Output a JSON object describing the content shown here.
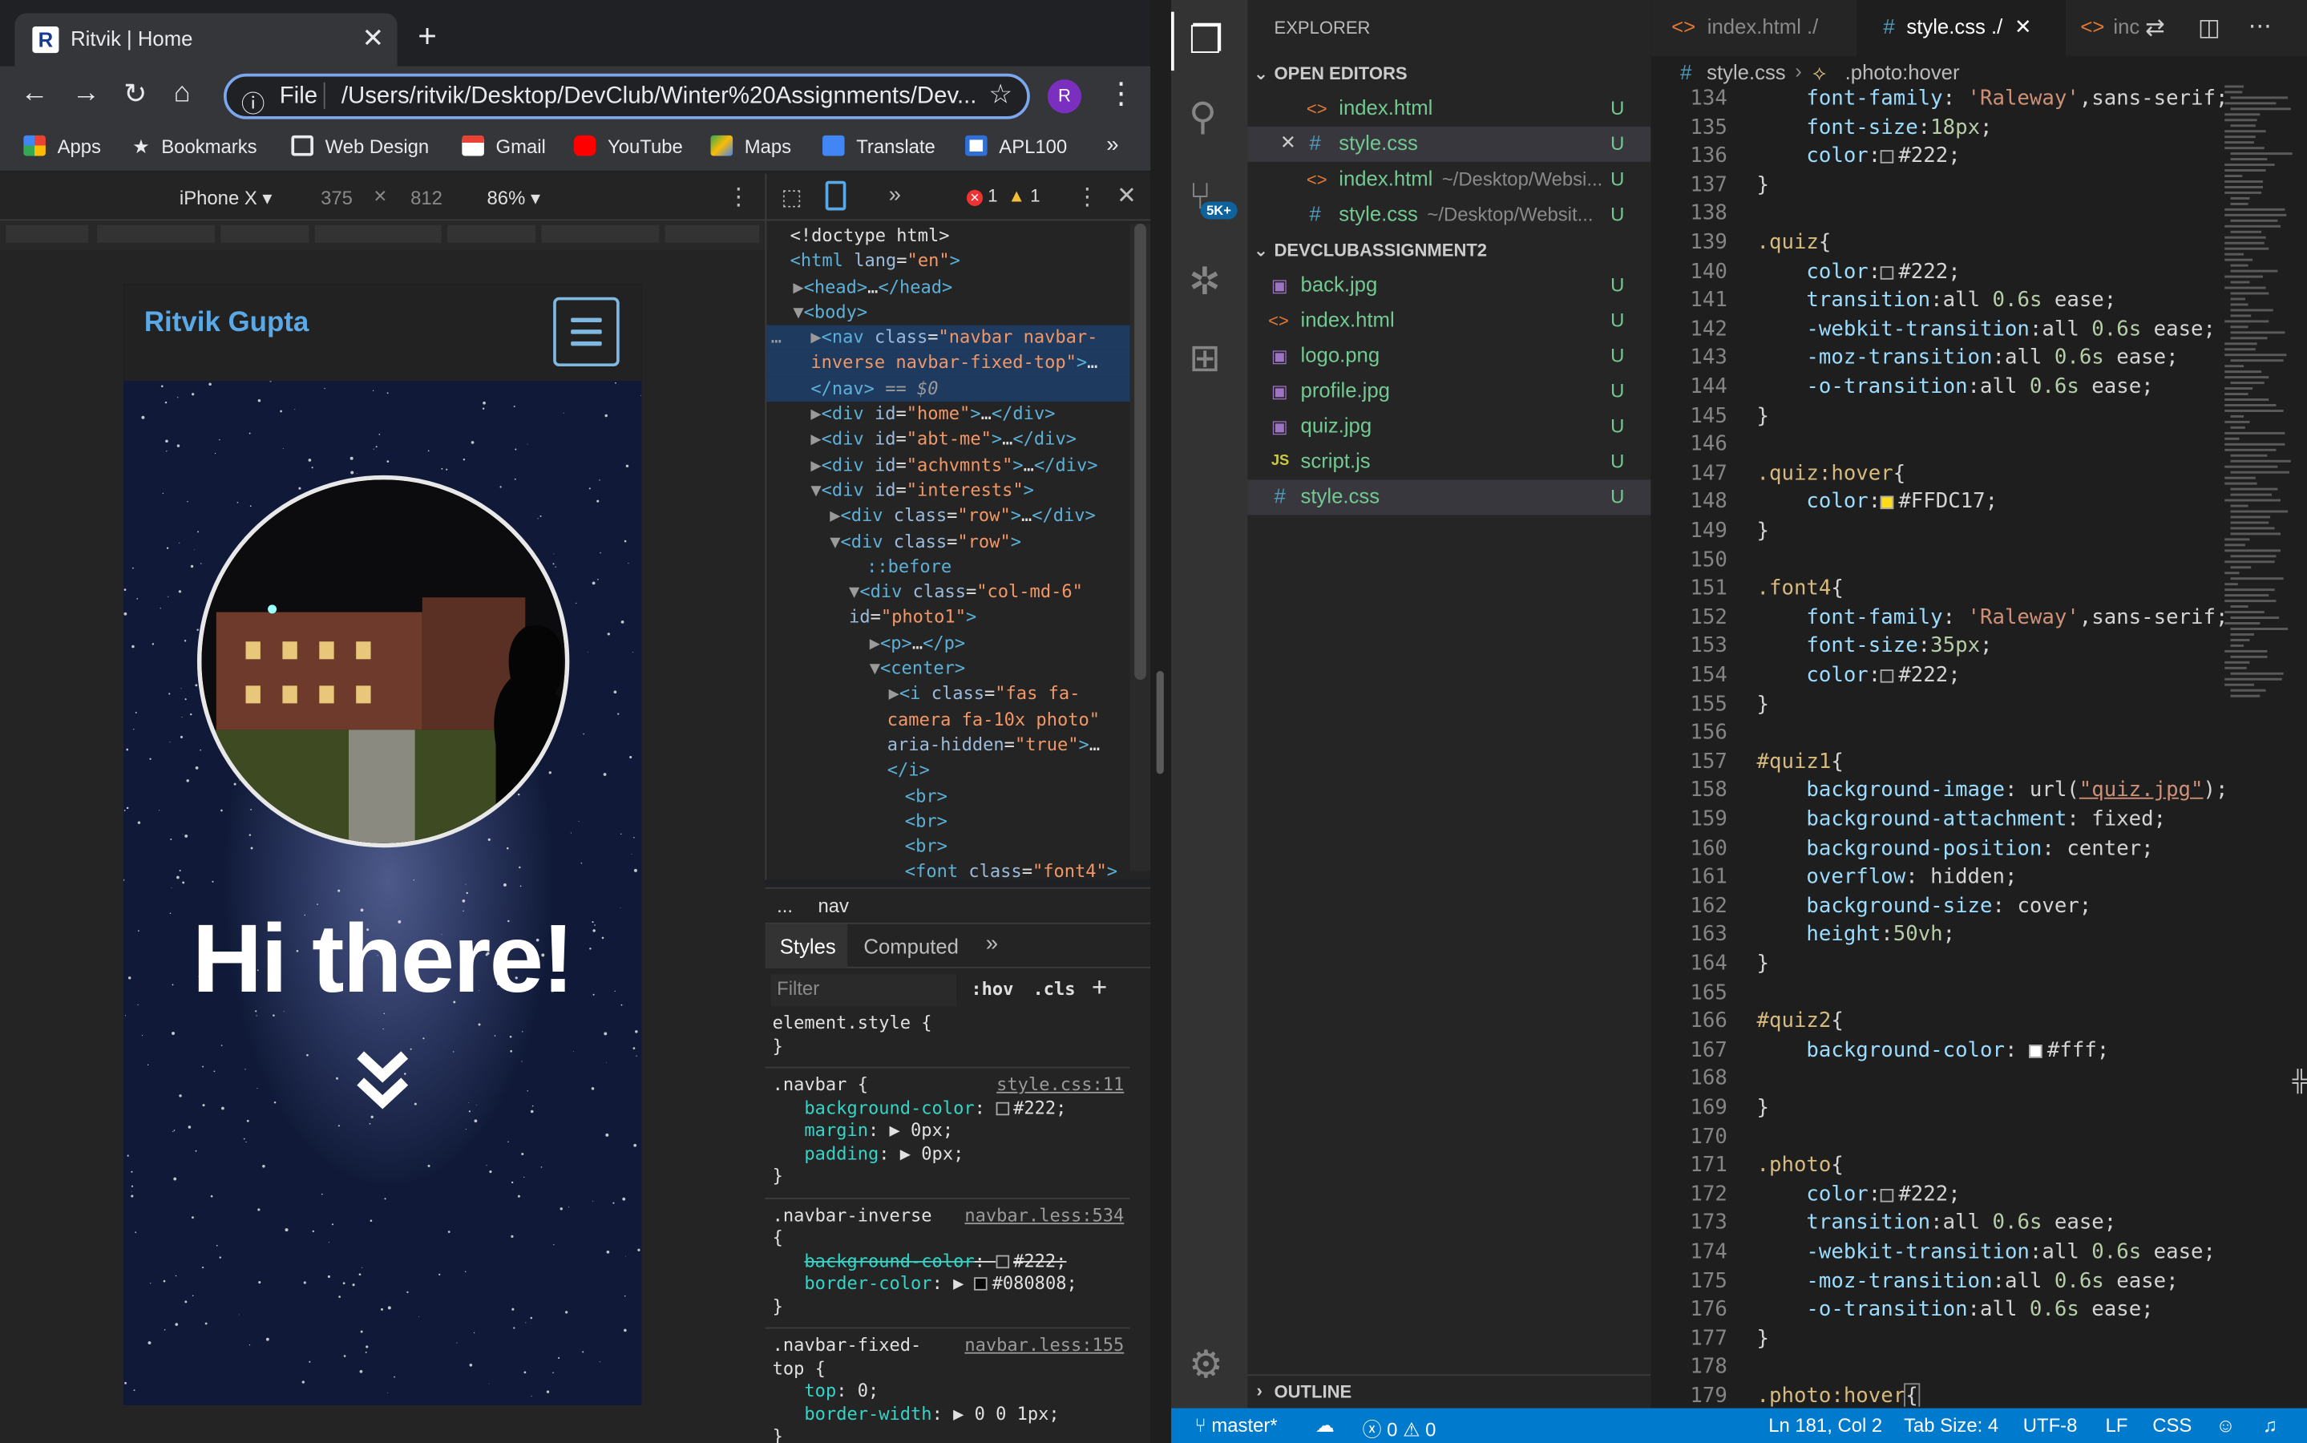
{
  "browser": {
    "tab_title": "Ritvik | Home",
    "omnibox_scheme": "File",
    "url": "/Users/ritvik/Desktop/DevClub/Winter%20Assignments/Dev...",
    "avatar_letter": "R",
    "bookmarks": [
      "Apps",
      "Bookmarks",
      "Web Design",
      "Gmail",
      "YouTube",
      "Maps",
      "Translate",
      "APL100"
    ],
    "more_bookmarks": "»"
  },
  "devtools": {
    "device": "iPhone X",
    "width": "375",
    "times": "×",
    "height": "812",
    "zoom": "86%",
    "errors": "1",
    "warnings": "1",
    "breadcrumb_dots": "...",
    "breadcrumb_item": "nav",
    "styles_tab": "Styles",
    "computed_tab": "Computed",
    "more_tabs": "»",
    "filter_placeholder": "Filter",
    "hov": ":hov",
    "cls": ".cls",
    "plus": "+"
  },
  "phone_page": {
    "brand": "Ritvik Gupta",
    "heading": "Hi there!",
    "scroll_icon": "chevron-double-down-icon"
  },
  "vscode": {
    "explorer_title": "EXPLORER",
    "open_editors": "OPEN EDITORS",
    "folder": "DEVCLUBASSIGNMENT2",
    "outline": "OUTLINE",
    "tabs": [
      "index.html ./",
      "style.css ./",
      "inc"
    ],
    "breadcrumb_file": "style.css",
    "breadcrumb_symbol": ".photo:hover",
    "open_editor_files": [
      {
        "name": "index.html",
        "path": "",
        "status": "U"
      },
      {
        "name": "style.css",
        "path": "",
        "status": "U"
      },
      {
        "name": "index.html",
        "path": "~/Desktop/Websi...",
        "status": "U"
      },
      {
        "name": "style.css",
        "path": "~/Desktop/Websit...",
        "status": "U"
      }
    ],
    "folder_files": [
      {
        "name": "back.jpg",
        "status": "U"
      },
      {
        "name": "index.html",
        "status": "U"
      },
      {
        "name": "logo.png",
        "status": "U"
      },
      {
        "name": "profile.jpg",
        "status": "U"
      },
      {
        "name": "quiz.jpg",
        "status": "U"
      },
      {
        "name": "script.js",
        "status": "U"
      },
      {
        "name": "style.css",
        "status": "U"
      }
    ],
    "status": {
      "branch": "master*",
      "errors": "0",
      "warnings": "0",
      "position": "Ln 181, Col 2",
      "tab_size": "Tab Size: 4",
      "encoding": "UTF-8",
      "eol": "LF",
      "language": "CSS"
    },
    "source_control_badge": "5K+"
  },
  "colors": {
    "vscode_status": "#007acc",
    "accent_blue": "#5aa9e6",
    "untracked": "#73c991"
  }
}
